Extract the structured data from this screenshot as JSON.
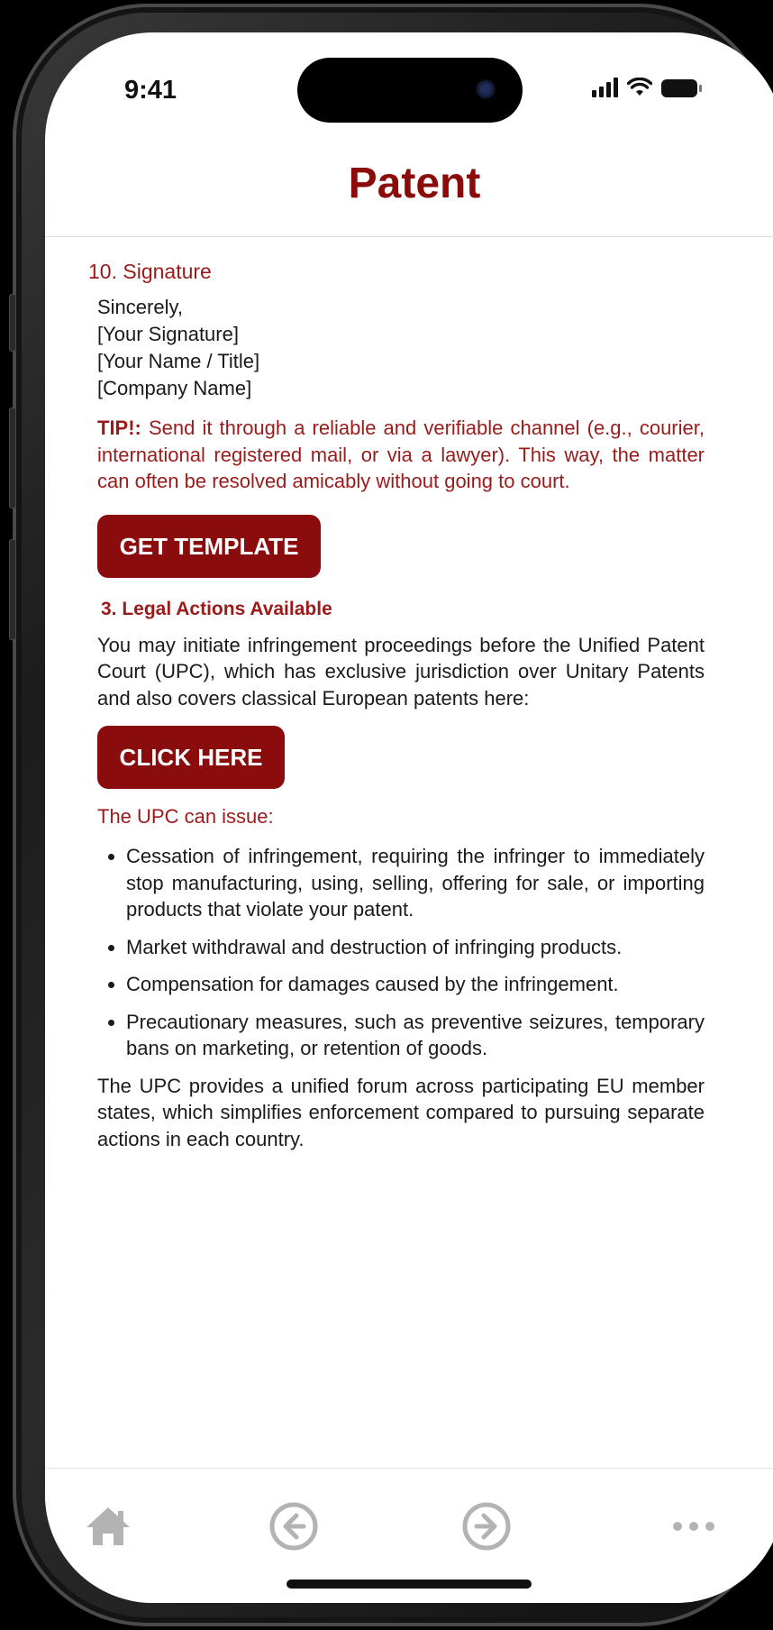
{
  "status_bar": {
    "time": "9:41",
    "icons": [
      "signal-icon",
      "wifi-icon",
      "battery-icon"
    ]
  },
  "nav": {
    "title": "Patent"
  },
  "signature": {
    "label": "10. Signature",
    "lines": [
      "Sincerely,",
      "[Your Signature]",
      "[Your Name / Title]",
      "[Company Name]"
    ]
  },
  "tip": {
    "label": "TIP!:",
    "text": " Send it through a reliable and verifiable channel (e.g., courier, international registered mail, or via a lawyer). This way, the matter can often be resolved amicably without going to court."
  },
  "buttons": {
    "get_template": "GET TEMPLATE",
    "click_here": "CLICK HERE"
  },
  "legal": {
    "heading": "3. Legal Actions Available",
    "intro": "You may initiate infringement proceedings before the Unified Patent Court (UPC), which has exclusive jurisdiction over Unitary Patents and also covers classical European patents here:",
    "upc_label": "The UPC can issue:",
    "items": [
      "Cessation of infringement, requiring the infringer to immediately stop manufacturing, using, selling, offering for sale, or importing products that violate your patent.",
      "Market withdrawal and destruction of infringing products.",
      "Compensation for damages caused by the infringement.",
      "Precautionary measures, such as preventive seizures, temporary bans on marketing, or retention of goods."
    ],
    "closing": "The UPC provides a unified forum across participating EU member states, which simplifies enforcement compared to pursuing separate actions in each country."
  },
  "tab_bar": {
    "icons": [
      "home-icon",
      "back-arrow-icon",
      "forward-arrow-icon",
      "more-icon"
    ],
    "icon_color": "#b3b3b3"
  },
  "colors": {
    "accent": "#8a0c0c",
    "accent_text": "#9b1b1b"
  }
}
